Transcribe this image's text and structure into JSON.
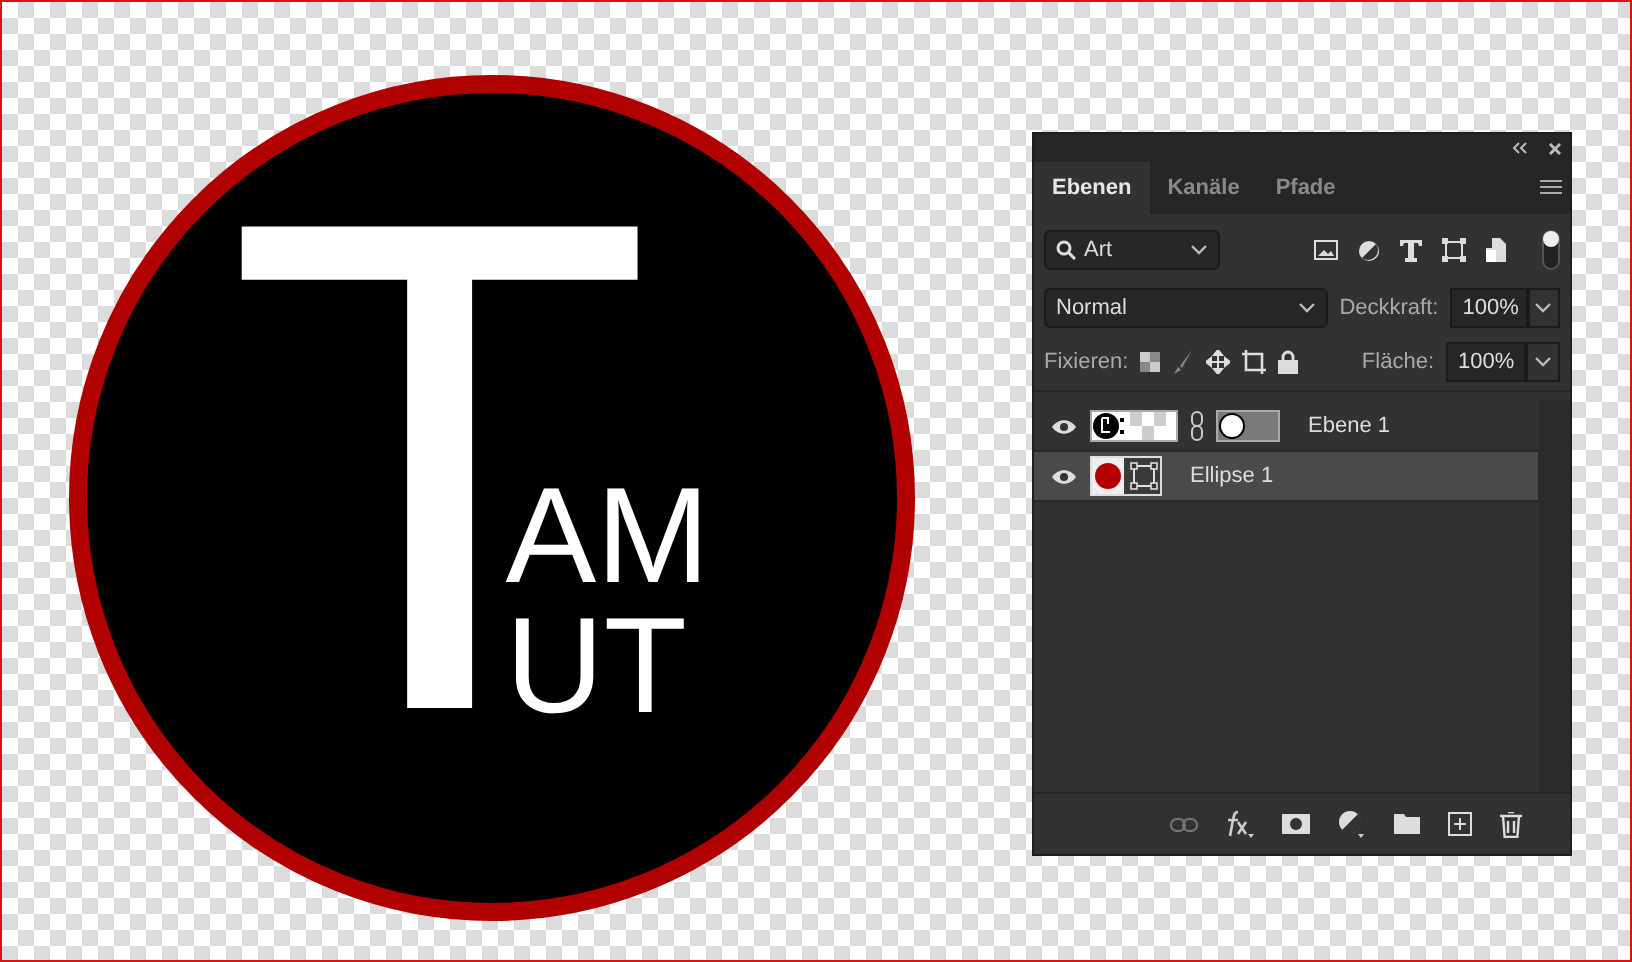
{
  "canvas": {
    "logo": {
      "big_letter": "T",
      "line_1": "AM",
      "line_2": "UT"
    }
  },
  "panel": {
    "tabs": [
      {
        "label": "Ebenen",
        "selected": true
      },
      {
        "label": "Kanäle",
        "selected": false
      },
      {
        "label": "Pfade",
        "selected": false
      }
    ],
    "filter": {
      "value": "Art"
    },
    "blend_mode": "Normal",
    "opacity_label": "Deckkraft:",
    "opacity": "100%",
    "lock_label": "Fixieren:",
    "fill_label": "Fläche:",
    "fill": "100%",
    "layers": [
      {
        "name": "Ebene 1",
        "kind": "masked",
        "visible": true,
        "selected": false
      },
      {
        "name": "Ellipse 1",
        "kind": "shape",
        "visible": true,
        "selected": true
      }
    ]
  }
}
